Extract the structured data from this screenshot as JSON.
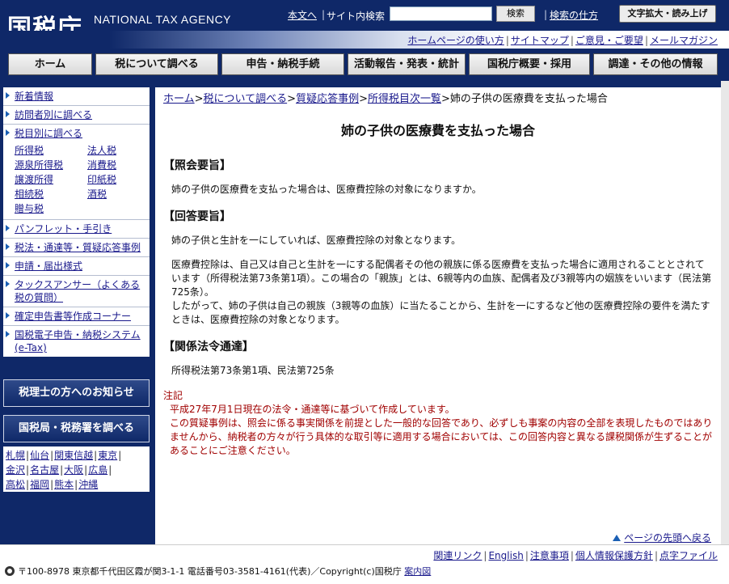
{
  "header": {
    "logo_ja": "国税庁",
    "logo_en": "NATIONAL TAX AGENCY",
    "main_text_link": "本文へ",
    "site_search_label": "サイト内検索",
    "search_placeholder": "",
    "search_button": "検索",
    "search_howto": "検索の仕方",
    "text_size_button": "文字拡大・読み上げ"
  },
  "sub_links": [
    "ホームページの使い方",
    "サイトマップ",
    "ご意見・ご要望",
    "メールマガジン"
  ],
  "global_nav": [
    "ホーム",
    "税について調べる",
    "申告・納税手続",
    "活動報告・発表・統計",
    "国税庁概要・採用",
    "調達・その他の情報"
  ],
  "sidebar": {
    "menu_top": [
      "新着情報",
      "訪問者別に調べる",
      "税目別に調べる"
    ],
    "tax_types": [
      "所得税",
      "法人税",
      "源泉所得税",
      "消費税",
      "譲渡所得",
      "印紙税",
      "相続税",
      "酒税",
      "贈与税"
    ],
    "menu_bottom": [
      "パンフレット・手引き",
      "税法・通達等・質疑応答事例",
      "申請・届出様式",
      "タックスアンサー（よくある税の質問）",
      "確定申告書等作成コーナー",
      "国税電子申告・納税システム(e-Tax)"
    ],
    "banner_accountants": "税理士の方へのお知らせ",
    "banner_offices": "国税局・税務署を調べる",
    "offices": [
      "札幌",
      "仙台",
      "関東信越",
      "東京",
      "金沢",
      "名古屋",
      "大阪",
      "広島",
      "高松",
      "福岡",
      "熊本",
      "沖縄"
    ]
  },
  "breadcrumb": {
    "items": [
      "ホーム",
      "税について調べる",
      "質疑応答事例",
      "所得税目次一覧"
    ],
    "sep": ">",
    "current": "姉の子供の医療費を支払った場合"
  },
  "main": {
    "title": "姉の子供の医療費を支払った場合",
    "h_query": "【照会要旨】",
    "query_text": "姉の子供の医療費を支払った場合は、医療費控除の対象になりますか。",
    "h_answer": "【回答要旨】",
    "answer_p1": "姉の子供と生計を一にしていれば、医療費控除の対象となります。",
    "answer_p2": "医療費控除は、自己又は自己と生計を一にする配偶者その他の親族に係る医療費を支払った場合に適用されることとされています（所得税法第73条第1項）。この場合の「親族」とは、6親等内の血族、配偶者及び3親等内の姻族をいいます（民法第725条）。",
    "answer_p3": "したがって、姉の子供は自己の親族（3親等の血族）に当たることから、生計を一にするなど他の医療費控除の要件を満たすときは、医療費控除の対象となります。",
    "h_law": "【関係法令通達】",
    "law_text": "所得税法第73条第1項、民法第725条",
    "note_label": "注記",
    "note_1": "平成27年7月1日現在の法令・通達等に基づいて作成しています。",
    "note_2": "この質疑事例は、照会に係る事実関係を前提とした一般的な回答であり、必ずしも事案の内容の全部を表現したものではありませんから、納税者の方々が行う具体的な取引等に適用する場合においては、この回答内容と異なる課税関係が生ずることがあることにご注意ください。",
    "to_top": "ページの先頭へ戻る"
  },
  "footer": {
    "links": [
      "関連リンク",
      "English",
      "注意事項",
      "個人情報保護方針",
      "点字ファイル"
    ],
    "address": "〒100-8978 東京都千代田区霞が関3-1-1 電話番号03-3581-4161(代表)／Copyright(c)国税庁",
    "map_link": "案内図"
  },
  "colors": {
    "navy": "#0f2868",
    "link": "#1a1a8c",
    "note_red": "#a00000"
  }
}
